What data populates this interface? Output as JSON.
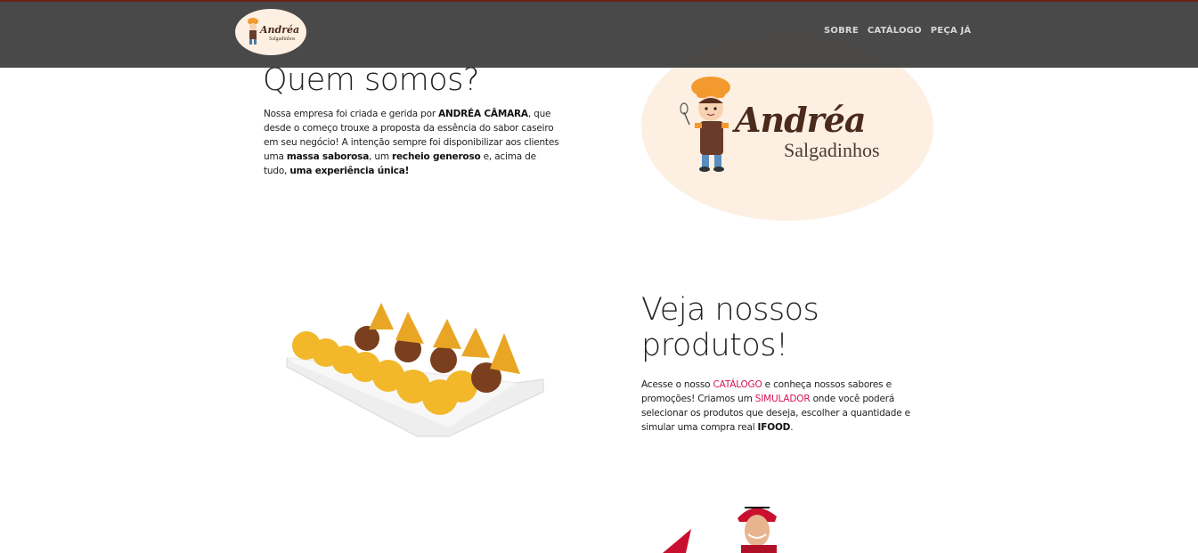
{
  "nav": {
    "links": [
      {
        "label": "SOBRE"
      },
      {
        "label": "CATÁLOGO"
      },
      {
        "label": "PEÇA JÁ"
      }
    ]
  },
  "about": {
    "title": "Quem somos?",
    "p": {
      "t1": "Nossa empresa foi criada e gerida por ",
      "b1": "ANDRÉA CÂMARA",
      "t2": ", que desde o começo trouxe a proposta da essência do sabor caseiro em seu negócio! A intenção sempre foi disponibilizar aos clientes uma ",
      "b2": "massa saborosa",
      "t3": ", um ",
      "b3": "recheio generoso",
      "t4": " e, acima de tudo, ",
      "b4": "uma experiência única!"
    }
  },
  "brand": {
    "name": "Andréa",
    "sub": "Salgadinhos"
  },
  "products": {
    "title_line1": "Veja nossos",
    "title_line2": "produtos!",
    "p": {
      "t1": "Acesse o nosso ",
      "link1": "CATÁLOGO",
      "t2": " e conheça nossos sabores e promoções! Criamos um ",
      "link2": "SIMULADOR",
      "t3": " onde você poderá selecionar os produtos que deseja, escolher a quantidade e simular uma compra real ",
      "b1": "IFOOD",
      "t4": "."
    }
  },
  "colors": {
    "navbar": "#3a3a3a",
    "accent_pink": "#d4145a",
    "logo_bg": "#fdf0e2",
    "brand_brown": "#4a2a1c"
  },
  "icons": {
    "nav_logo": "chef-logo-icon",
    "big_logo": "chef-mascot-icon",
    "food": "salgadinhos-tray-image",
    "biker": "delivery-biker-image"
  }
}
